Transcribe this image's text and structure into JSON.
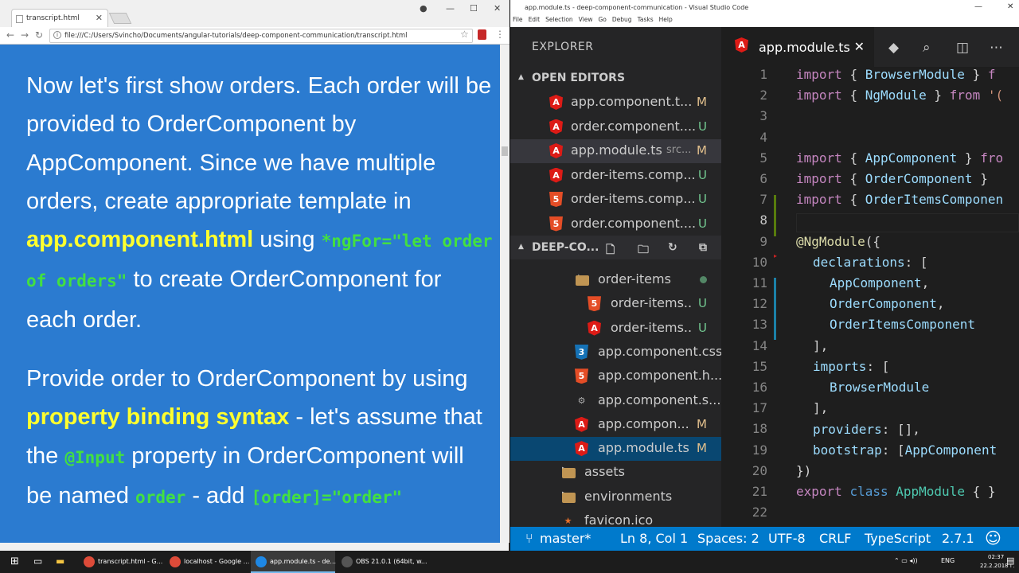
{
  "chrome": {
    "tab_title": "transcript.html",
    "url": "file:///C:/Users/Svincho/Documents/angular-tutorials/deep-component-communication/transcript.html"
  },
  "content": {
    "p1_a": "Now let's first show orders. Each order will be provided to OrderComponent by AppComponent. Since we have multiple orders, create appropriate template in ",
    "p1_hl": "app.component.html",
    "p1_b": " using ",
    "p1_code": "*ngFor=\"let order of orders\"",
    "p1_c": " to create OrderComponent for each order.",
    "p2_a": "Provide order to OrderComponent by using ",
    "p2_hl": "property binding syntax",
    "p2_b": " - let's assume that the ",
    "p2_code1": "@Input",
    "p2_c": " property in OrderComponent will be named ",
    "p2_code2": "order",
    "p2_d": " - add ",
    "p2_code3": "[order]=\"order\""
  },
  "vscode": {
    "title": "app.module.ts - deep-component-communication - Visual Studio Code",
    "menu": [
      "File",
      "Edit",
      "Selection",
      "View",
      "Go",
      "Debug",
      "Tasks",
      "Help"
    ],
    "explorer_label": "EXPLORER",
    "open_editors_label": "OPEN EDITORS",
    "open_editors": [
      {
        "name": "app.component.t...",
        "badge": "M",
        "icon": "angular-icon",
        "sym": "A"
      },
      {
        "name": "order.component....",
        "badge": "U",
        "icon": "angular-icon",
        "sym": "A"
      },
      {
        "name": "app.module.ts",
        "hint": "src...",
        "badge": "M",
        "icon": "angular-icon",
        "sym": "A"
      },
      {
        "name": "order-items.comp...",
        "badge": "U",
        "icon": "angular-icon",
        "sym": "A"
      },
      {
        "name": "order-items.comp...",
        "badge": "U",
        "icon": "html5-icon",
        "sym": "5"
      },
      {
        "name": "order.component....",
        "badge": "U",
        "icon": "html5-icon",
        "sym": "5"
      }
    ],
    "project_label": "DEEP-CO...",
    "tree": [
      {
        "name": "order-items",
        "icon": "folder-icon",
        "indent": 110,
        "arrow": "▲",
        "dot": true
      },
      {
        "name": "order-items..",
        "badge": "U",
        "icon": "html5-icon",
        "sym": "5",
        "indent": 126
      },
      {
        "name": "order-items..",
        "badge": "U",
        "icon": "angular-icon",
        "sym": "A",
        "indent": 126
      },
      {
        "name": "app.component.css",
        "icon": "css3-icon",
        "sym": "3",
        "indent": 110
      },
      {
        "name": "app.component.h...",
        "icon": "html5-icon",
        "sym": "5",
        "indent": 110
      },
      {
        "name": "app.component.s...",
        "icon": "gear-icon",
        "sym": "⚙",
        "indent": 110
      },
      {
        "name": "app.compon...",
        "badge": "M",
        "icon": "angular-icon",
        "sym": "A",
        "indent": 110
      },
      {
        "name": "app.module.ts",
        "badge": "M",
        "icon": "angular-icon",
        "sym": "A",
        "indent": 110,
        "selected": true
      },
      {
        "name": "assets",
        "icon": "folder-icon",
        "indent": 93,
        "arrow": "▶"
      },
      {
        "name": "environments",
        "icon": "folder-icon",
        "indent": 93,
        "arrow": "▶"
      },
      {
        "name": "favicon.ico",
        "icon": "favicon-icon",
        "sym": "★",
        "indent": 93
      }
    ],
    "tab_name": "app.module.ts",
    "line_numbers": [
      "1",
      "2",
      "3",
      "4",
      "5",
      "6",
      "7",
      "8",
      "9",
      "10",
      "11",
      "12",
      "13",
      "14",
      "15",
      "16",
      "17",
      "18",
      "19",
      "20",
      "21",
      "22"
    ],
    "status": {
      "branch": "master*",
      "position": "Ln 8, Col 1",
      "spaces": "Spaces: 2",
      "encoding": "UTF-8",
      "eol": "CRLF",
      "language": "TypeScript",
      "version": "2.7.1"
    }
  },
  "code": {
    "l1": [
      "import",
      "{ ",
      "BrowserModule",
      " } ",
      "f"
    ],
    "l2": [
      "import",
      "{ ",
      "NgModule",
      " } ",
      "from",
      "'("
    ],
    "l5": [
      "import",
      "{ ",
      "AppComponent",
      " } ",
      "fro"
    ],
    "l6": [
      "import",
      "{ ",
      "OrderComponent",
      " } "
    ],
    "l7": [
      "import",
      "{ ",
      "OrderItemsComponen"
    ],
    "l9": [
      "@NgModule",
      "({"
    ],
    "l10": [
      "declarations",
      ": ["
    ],
    "l11": [
      "AppComponent",
      ","
    ],
    "l12": [
      "OrderComponent",
      ","
    ],
    "l13": [
      "OrderItemsComponent"
    ],
    "l14": "],",
    "l15": [
      "imports",
      ": ["
    ],
    "l16": "BrowserModule",
    "l17": "],",
    "l18": [
      "providers",
      ": [],"
    ],
    "l19": [
      "bootstrap",
      ": [",
      "AppComponent"
    ],
    "l20": "})",
    "l21": [
      "export",
      "class",
      "AppModule",
      "{ }"
    ]
  },
  "taskbar": {
    "apps": [
      {
        "label": "transcript.html - G...",
        "color": "#dd4b39"
      },
      {
        "label": "localhost - Google ...",
        "color": "#dd4b39"
      },
      {
        "label": "app.module.ts - de...",
        "color": "#1e88e5"
      },
      {
        "label": "OBS 21.0.1 (64bit, w...",
        "color": "#555555"
      }
    ],
    "lang": "ENG",
    "time": "02:37",
    "date": "22.2.2018 г."
  }
}
